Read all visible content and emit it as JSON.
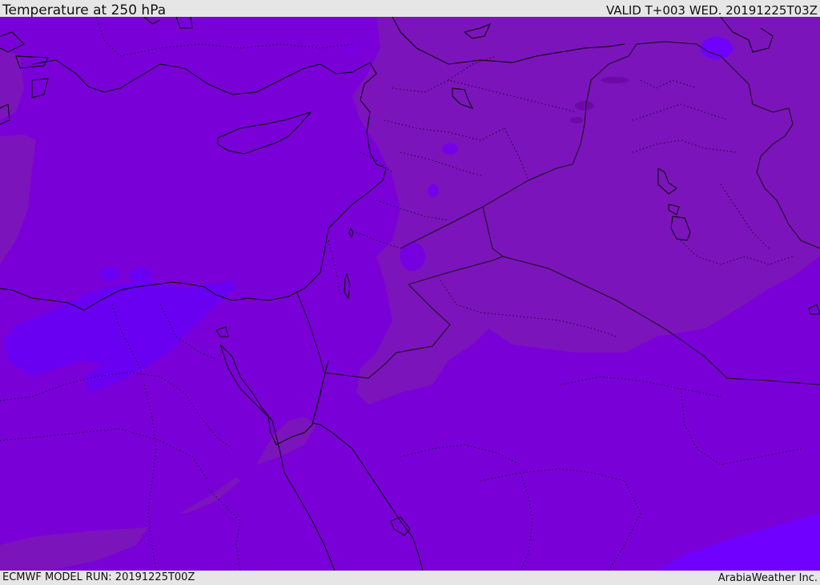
{
  "header": {
    "title": "Temperature at 250 hPa",
    "valid_time": "VALID T+003 WED. 20191225T03Z"
  },
  "footer": {
    "model_run": "ECMWF MODEL RUN: 20191225T00Z",
    "credit": "ArabiaWeather Inc."
  },
  "map": {
    "field": "temperature-250hPa",
    "colors": {
      "base": "#7a00d8",
      "warm": "#7c14bb",
      "warmest": "#6c0aa8",
      "cool": "#6a00f2",
      "coolest": "#7000ff",
      "coast": "#000000",
      "border": "#111111"
    },
    "layers": [
      "coastlines",
      "country-borders",
      "province-borders",
      "temperature-shading"
    ]
  }
}
